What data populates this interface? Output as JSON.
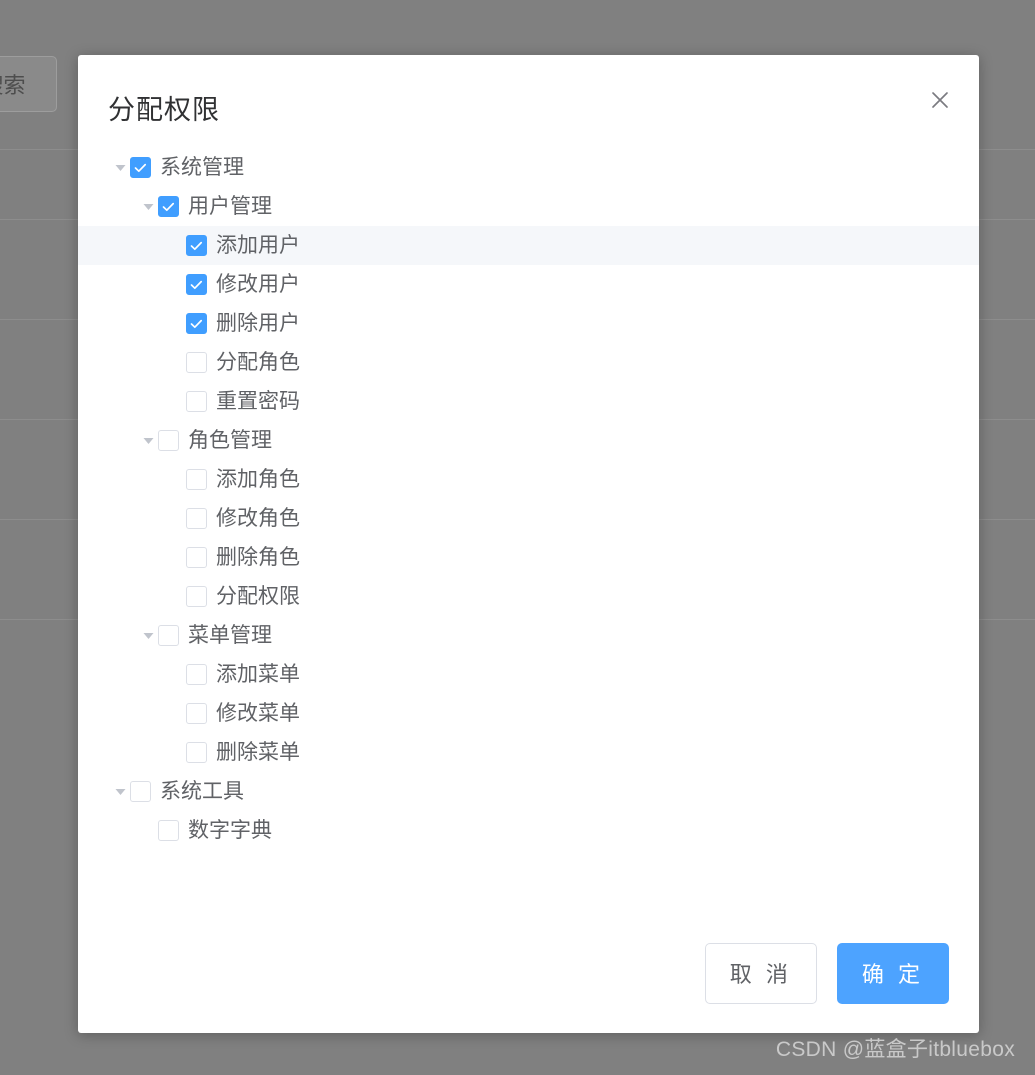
{
  "background": {
    "search_button_label": "搜索",
    "primary_button_label": "",
    "danger_button_label": ""
  },
  "dialog": {
    "title": "分配权限",
    "close_icon": "close-icon",
    "footer": {
      "cancel_label": "取 消",
      "confirm_label": "确 定"
    },
    "accent_color": "#409eff",
    "confirm_color": "#4da3ff",
    "highlight_color": "#f5f7fa",
    "tree": [
      {
        "label": "系统管理",
        "level": 0,
        "checked": true,
        "expandable": true,
        "expanded": true,
        "highlighted": false
      },
      {
        "label": "用户管理",
        "level": 1,
        "checked": true,
        "expandable": true,
        "expanded": true,
        "highlighted": false
      },
      {
        "label": "添加用户",
        "level": 2,
        "checked": true,
        "expandable": false,
        "expanded": false,
        "highlighted": true
      },
      {
        "label": "修改用户",
        "level": 2,
        "checked": true,
        "expandable": false,
        "expanded": false,
        "highlighted": false
      },
      {
        "label": "删除用户",
        "level": 2,
        "checked": true,
        "expandable": false,
        "expanded": false,
        "highlighted": false
      },
      {
        "label": "分配角色",
        "level": 2,
        "checked": false,
        "expandable": false,
        "expanded": false,
        "highlighted": false
      },
      {
        "label": "重置密码",
        "level": 2,
        "checked": false,
        "expandable": false,
        "expanded": false,
        "highlighted": false
      },
      {
        "label": "角色管理",
        "level": 1,
        "checked": false,
        "expandable": true,
        "expanded": true,
        "highlighted": false
      },
      {
        "label": "添加角色",
        "level": 2,
        "checked": false,
        "expandable": false,
        "expanded": false,
        "highlighted": false
      },
      {
        "label": "修改角色",
        "level": 2,
        "checked": false,
        "expandable": false,
        "expanded": false,
        "highlighted": false
      },
      {
        "label": "删除角色",
        "level": 2,
        "checked": false,
        "expandable": false,
        "expanded": false,
        "highlighted": false
      },
      {
        "label": "分配权限",
        "level": 2,
        "checked": false,
        "expandable": false,
        "expanded": false,
        "highlighted": false
      },
      {
        "label": "菜单管理",
        "level": 1,
        "checked": false,
        "expandable": true,
        "expanded": true,
        "highlighted": false
      },
      {
        "label": "添加菜单",
        "level": 2,
        "checked": false,
        "expandable": false,
        "expanded": false,
        "highlighted": false
      },
      {
        "label": "修改菜单",
        "level": 2,
        "checked": false,
        "expandable": false,
        "expanded": false,
        "highlighted": false
      },
      {
        "label": "删除菜单",
        "level": 2,
        "checked": false,
        "expandable": false,
        "expanded": false,
        "highlighted": false
      },
      {
        "label": "系统工具",
        "level": 0,
        "checked": false,
        "expandable": true,
        "expanded": true,
        "highlighted": false
      },
      {
        "label": "数字字典",
        "level": 1,
        "checked": false,
        "expandable": false,
        "expanded": false,
        "highlighted": false
      }
    ]
  },
  "watermark": {
    "text": "CSDN @蓝盒子itbluebox"
  }
}
